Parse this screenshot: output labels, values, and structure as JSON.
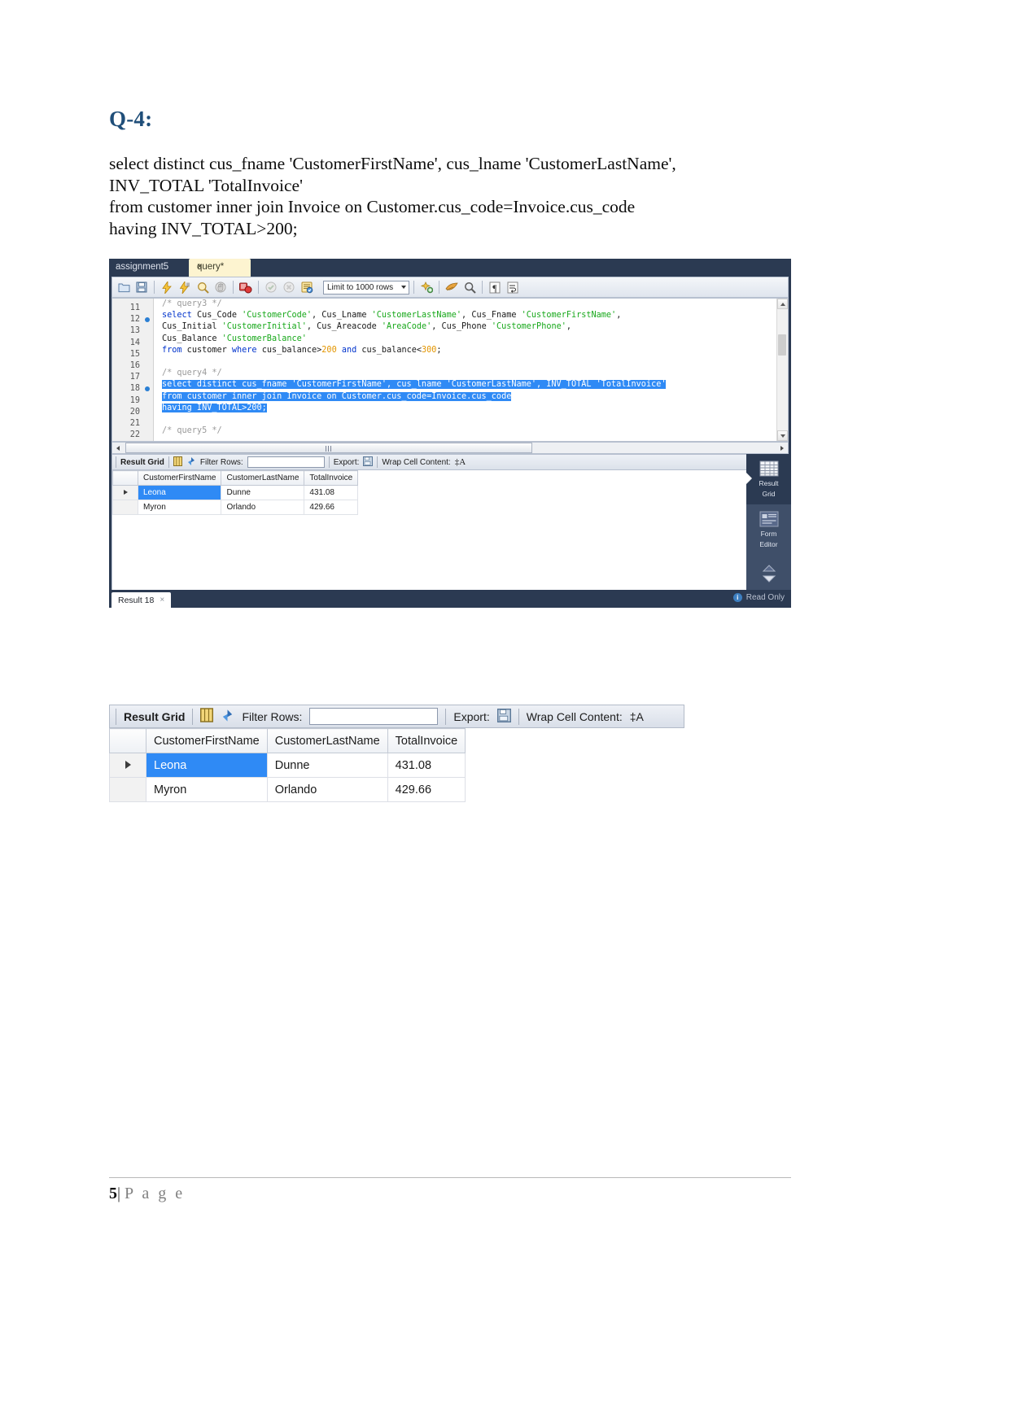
{
  "document": {
    "heading": "Q-4:",
    "query_lines": [
      "select distinct cus_fname 'CustomerFirstName', cus_lname 'CustomerLastName',",
      "INV_TOTAL 'TotalInvoice'",
      "from customer inner join Invoice on Customer.cus_code=Invoice.cus_code",
      "having INV_TOTAL>200;"
    ],
    "footer": {
      "page_number": "5",
      "separator": "|",
      "label": "P a g e"
    }
  },
  "workbench": {
    "tabs": {
      "schema_tab": "assignment5",
      "query_tab": "query*",
      "close": "×"
    },
    "toolbar": {
      "icons": [
        "open-folder-icon",
        "save-icon",
        "execute-lightning-icon",
        "execute-current-statement-icon",
        "explain-magnifier-icon",
        "stop-icon",
        "toggle-breakpoint-icon",
        "commit-icon",
        "rollback-icon",
        "autocommit-icon",
        "beautify-icon",
        "find-icon",
        "invisible-chars-icon",
        "wrap-lines-icon"
      ],
      "limit_label": "Limit to 1000 rows"
    },
    "editor": {
      "lines": [
        {
          "no": "11",
          "bp": false,
          "segments": [
            {
              "t": "/* query3 */",
              "c": "cmt"
            }
          ]
        },
        {
          "no": "12",
          "bp": true,
          "segments": [
            {
              "t": "select",
              "c": "kw"
            },
            {
              "t": " Cus_Code ",
              "c": ""
            },
            {
              "t": "'CustomerCode'",
              "c": "str"
            },
            {
              "t": ", Cus_Lname ",
              "c": ""
            },
            {
              "t": "'CustomerLastName'",
              "c": "str"
            },
            {
              "t": ", Cus_Fname ",
              "c": ""
            },
            {
              "t": "'CustomerFirstName'",
              "c": "str"
            },
            {
              "t": ",",
              "c": ""
            }
          ]
        },
        {
          "no": "13",
          "bp": false,
          "segments": [
            {
              "t": "Cus_Initial ",
              "c": ""
            },
            {
              "t": "'CustomerInitial'",
              "c": "str"
            },
            {
              "t": ", Cus_Areacode ",
              "c": ""
            },
            {
              "t": "'AreaCode'",
              "c": "str"
            },
            {
              "t": ", Cus_Phone ",
              "c": ""
            },
            {
              "t": "'CustomerPhone'",
              "c": "str"
            },
            {
              "t": ",",
              "c": ""
            }
          ]
        },
        {
          "no": "14",
          "bp": false,
          "segments": [
            {
              "t": "Cus_Balance ",
              "c": ""
            },
            {
              "t": "'CustomerBalance'",
              "c": "str"
            }
          ]
        },
        {
          "no": "15",
          "bp": false,
          "segments": [
            {
              "t": "from",
              "c": "kw"
            },
            {
              "t": " customer ",
              "c": ""
            },
            {
              "t": "where",
              "c": "kw"
            },
            {
              "t": " cus_balance>",
              "c": ""
            },
            {
              "t": "200",
              "c": "num"
            },
            {
              "t": " and",
              "c": "kw"
            },
            {
              "t": " cus_balance<",
              "c": ""
            },
            {
              "t": "300",
              "c": "num"
            },
            {
              "t": ";",
              "c": ""
            }
          ]
        },
        {
          "no": "16",
          "bp": false,
          "segments": []
        },
        {
          "no": "17",
          "bp": false,
          "segments": [
            {
              "t": "/* query4 */",
              "c": "cmt"
            }
          ]
        },
        {
          "no": "18",
          "bp": true,
          "selected": true,
          "segments": [
            {
              "t": "select distinct cus_fname 'CustomerFirstName', cus_lname 'CustomerLastName', INV_TOTAL 'TotalInvoice'",
              "c": ""
            }
          ]
        },
        {
          "no": "19",
          "bp": false,
          "selected": true,
          "segments": [
            {
              "t": "from customer inner join Invoice on Customer.cus_code=Invoice.cus_code",
              "c": ""
            }
          ]
        },
        {
          "no": "20",
          "bp": false,
          "selected": true,
          "segments": [
            {
              "t": "having INV_TOTAL>200;",
              "c": ""
            }
          ]
        },
        {
          "no": "21",
          "bp": false,
          "segments": []
        },
        {
          "no": "22",
          "bp": false,
          "segments": [
            {
              "t": "/* query5 */",
              "c": "cmt"
            }
          ]
        }
      ]
    },
    "results_toolbar": {
      "result_grid_label": "Result Grid",
      "filter_label": "Filter Rows:",
      "filter_value": "",
      "export_label": "Export:",
      "wrap_label": "Wrap Cell Content:",
      "wrap_icon": "‡A",
      "icons": [
        "grid-columns-icon",
        "refresh-icon",
        "export-icon",
        "wrap-cell-icon",
        "fetch-all-icon"
      ]
    },
    "grid": {
      "columns": [
        "CustomerFirstName",
        "CustomerLastName",
        "TotalInvoice"
      ],
      "rows": [
        {
          "marker": "▶",
          "selected": true,
          "cells": [
            "Leona",
            "Dunne",
            "431.08"
          ]
        },
        {
          "marker": "",
          "selected": false,
          "cells": [
            "Myron",
            "Orlando",
            "429.66"
          ]
        }
      ]
    },
    "side_panel": {
      "items": [
        {
          "label_line1": "Result",
          "label_line2": "Grid",
          "icon": "result-grid-icon",
          "active": true
        },
        {
          "label_line1": "Form",
          "label_line2": "Editor",
          "icon": "form-editor-icon",
          "active": false
        }
      ],
      "expand_icon": "chevron-updown-icon"
    },
    "bottom": {
      "result_tab_label": "Result 18",
      "result_tab_close": "×",
      "status_text": "Read Only",
      "status_icon": "info-icon"
    },
    "colors": {
      "window_chrome": "#2b3a52",
      "selection_blue": "#2f8af5",
      "side_panel": "#3f4f69",
      "heading_blue": "#1f4e79"
    }
  },
  "enlarged_grid": {
    "toolbar": {
      "result_grid_label": "Result Grid",
      "filter_label": "Filter Rows:",
      "filter_value": "",
      "export_label": "Export:",
      "wrap_label": "Wrap Cell Content:",
      "wrap_icon": "‡A"
    },
    "columns": [
      "CustomerFirstName",
      "CustomerLastName",
      "TotalInvoice"
    ],
    "rows": [
      {
        "marker": "▶",
        "selected": true,
        "cells": [
          "Leona",
          "Dunne",
          "431.08"
        ]
      },
      {
        "marker": "",
        "selected": false,
        "cells": [
          "Myron",
          "Orlando",
          "429.66"
        ]
      }
    ]
  }
}
